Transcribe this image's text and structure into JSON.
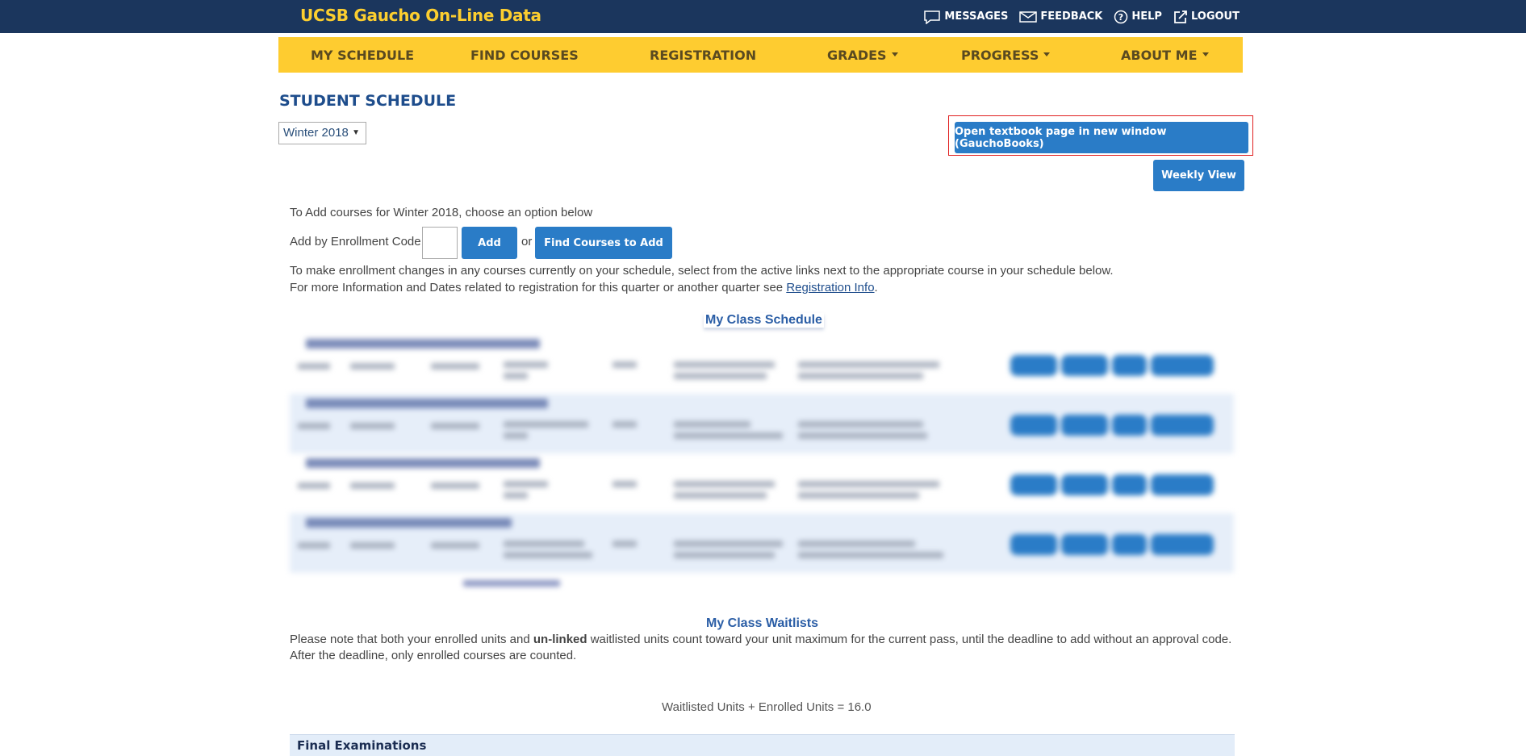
{
  "header": {
    "brand": "UCSB Gaucho On-Line Data",
    "links": {
      "messages": "MESSAGES",
      "feedback": "FEEDBACK",
      "help": "HELP",
      "logout": "LOGOUT"
    }
  },
  "nav": {
    "my_schedule": "MY SCHEDULE",
    "find_courses": "FIND COURSES",
    "registration": "REGISTRATION",
    "grades": "GRADES",
    "progress": "PROGRESS",
    "about_me": "ABOUT ME"
  },
  "page": {
    "title": "STUDENT SCHEDULE",
    "quarter_selected": "Winter 2018",
    "textbook_button": "Open textbook page in new window (GauchoBooks)",
    "weekly_view_button": "Weekly View"
  },
  "add_section": {
    "intro": "To Add courses for Winter 2018, choose an option below",
    "enroll_label": "Add by Enrollment Code:",
    "add_button": "Add",
    "or_text": "or",
    "find_button": "Find Courses to Add",
    "change_text": "To make enrollment changes in any courses currently on your schedule, select from the active links next to the appropriate course in your schedule below.",
    "info_prefix": "For more Information and Dates related to registration for this quarter or another quarter see ",
    "info_link": "Registration Info",
    "info_suffix": "."
  },
  "schedule": {
    "title": "My Class Schedule"
  },
  "waitlists": {
    "title": "My Class Waitlists",
    "note_prefix": "Please note that both your enrolled units and ",
    "note_bold": "un-linked",
    "note_suffix": " waitlisted units count toward your unit maximum for the current pass, until the deadline to add without an approval code.",
    "note_line2": "After the deadline, only enrolled courses are counted.",
    "units_summary": "Waitlisted Units + Enrolled Units = 16.0"
  },
  "finals": {
    "title": "Final Examinations"
  },
  "colors": {
    "topbar": "#1b365d",
    "brand": "#fcce2f",
    "nav": "#fecc30",
    "button": "#2a7cc7",
    "title": "#1e4d8c",
    "highlight": "#e02020"
  }
}
